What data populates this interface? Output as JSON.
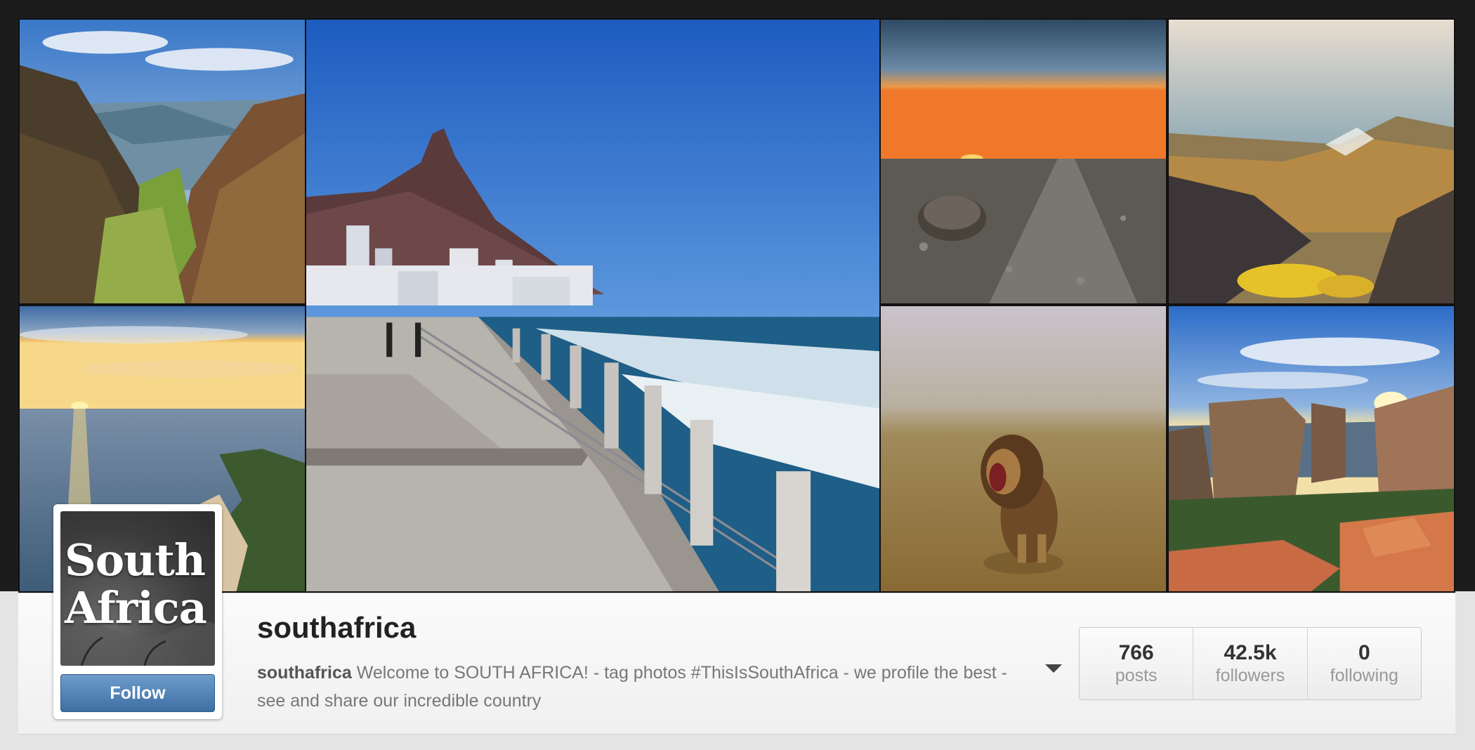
{
  "profile": {
    "avatar_text_line1": "South",
    "avatar_text_line2": "Africa",
    "follow_label": "Follow",
    "username": "southafrica",
    "bio_name": "southafrica",
    "bio_text": " Welcome to SOUTH AFRICA! - tag photos #ThisIsSouthAfrica - we profile the best - see and share our incredible country"
  },
  "stats": [
    {
      "value": "766",
      "label": "posts"
    },
    {
      "value": "42.5k",
      "label": "followers"
    },
    {
      "value": "0",
      "label": "following"
    }
  ],
  "colors": {
    "follow_button": "#4a7bb0",
    "page_dark": "#1c1c1c",
    "profile_bar": "#f6f6f6"
  },
  "icons": {
    "bio_toggle": "caret-down-icon"
  }
}
